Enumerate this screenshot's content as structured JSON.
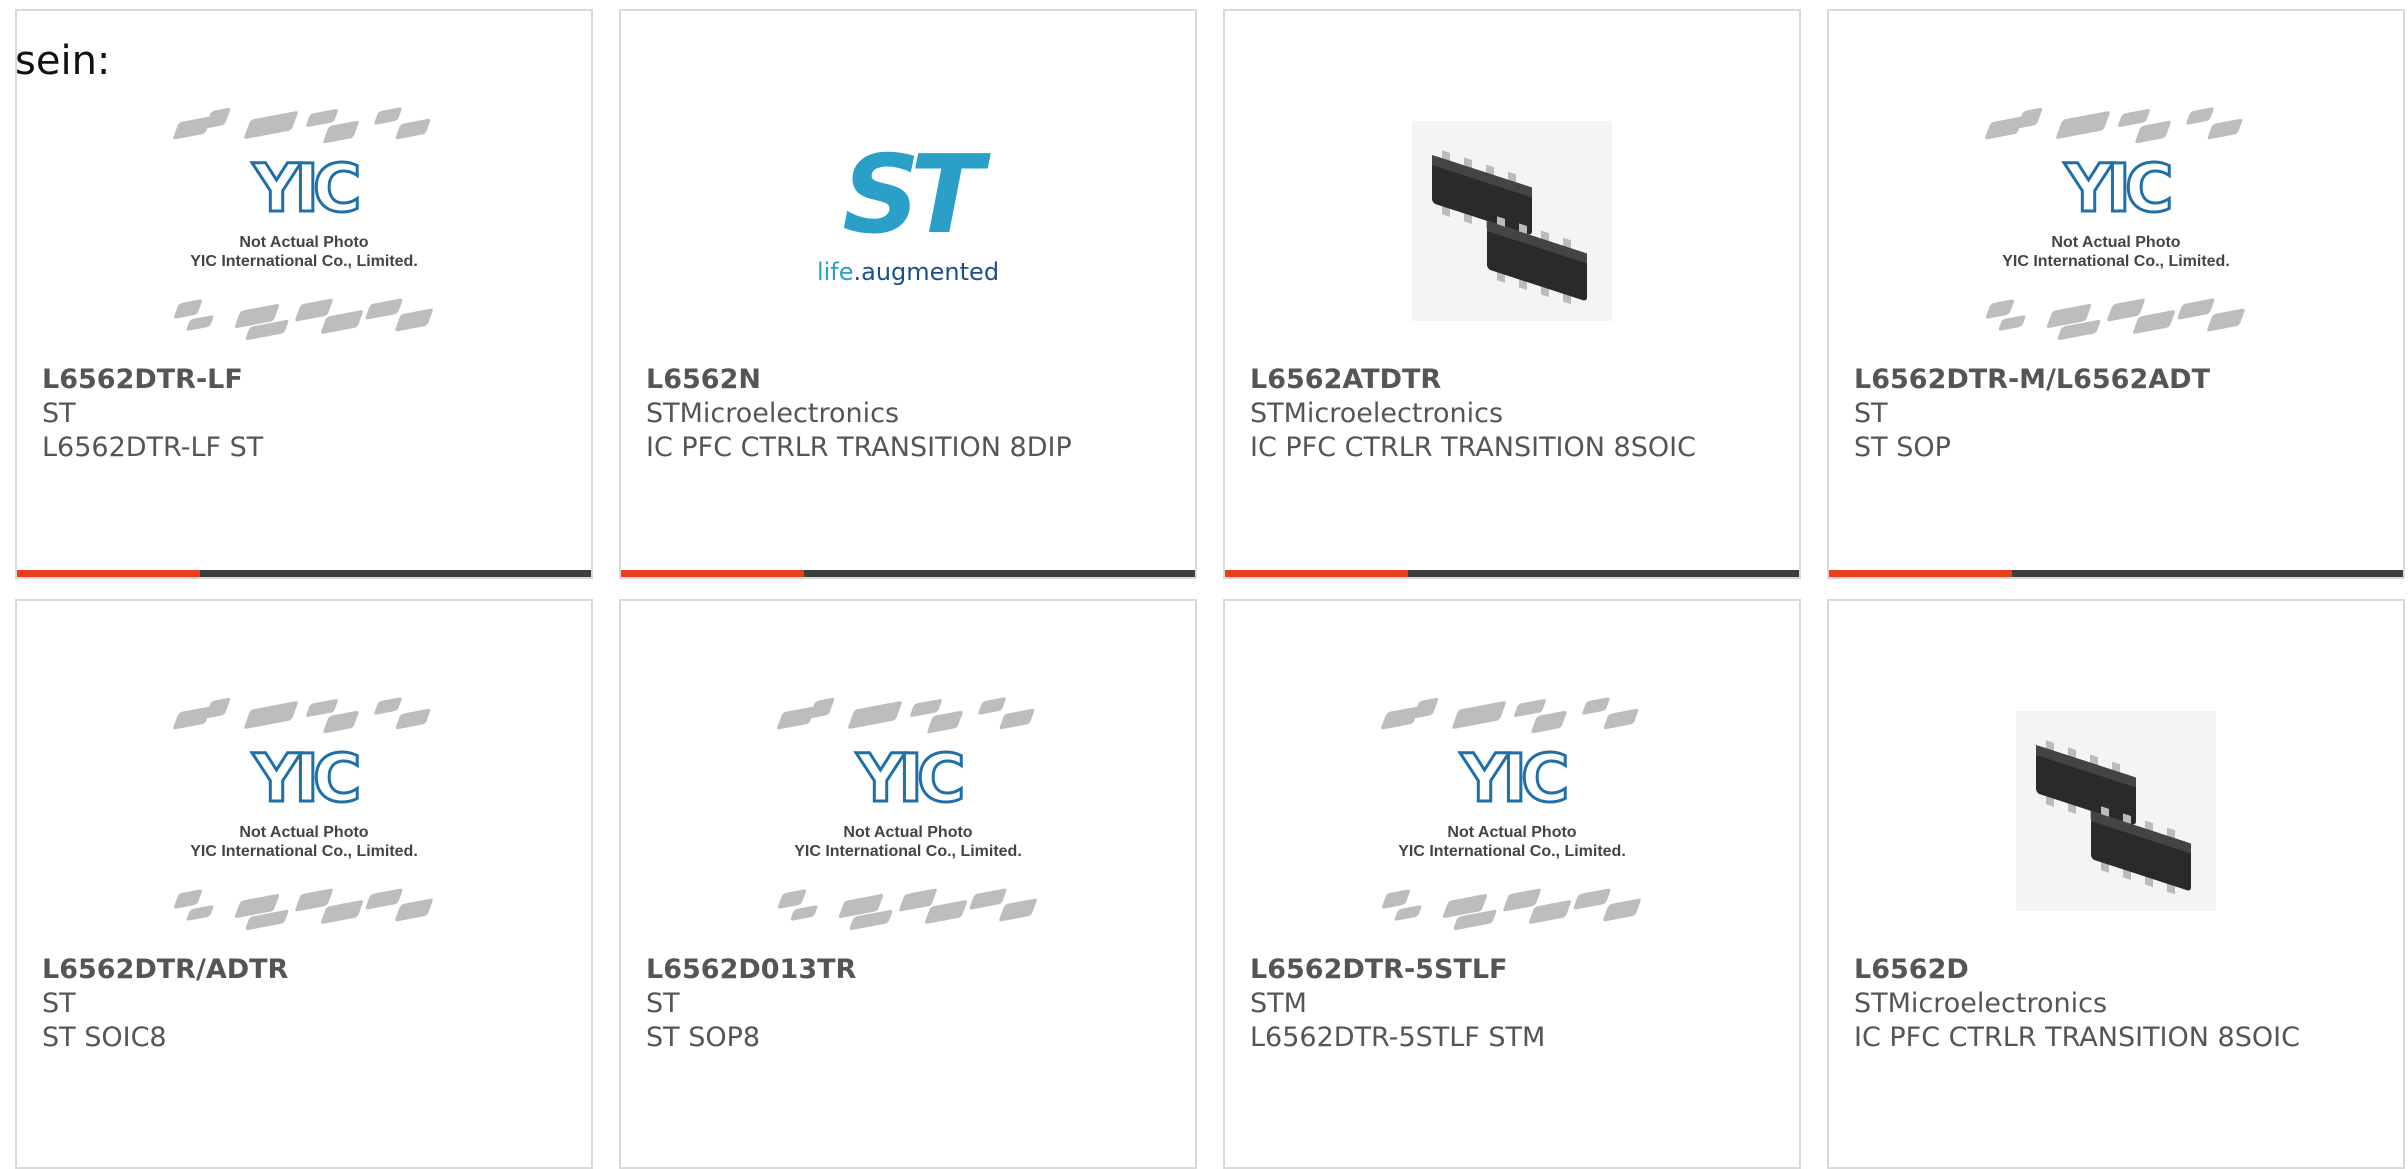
{
  "intro_text": "sein:",
  "placeholder_caption": [
    "Not Actual Photo",
    "YIC International Co., Limited."
  ],
  "logo_text": {
    "yic": "YIC",
    "st": "ST",
    "st_tag_1": "life",
    "st_tag_2": ".augmented"
  },
  "colors": {
    "accent": "#e8401c",
    "bar": "#3d3d3d",
    "border": "#d9d9d9",
    "text": "#555555"
  },
  "products": [
    {
      "part": "L6562DTR-LF",
      "maker": "ST",
      "desc": "L6562DTR-LF ST",
      "image": "yic-placeholder"
    },
    {
      "part": "L6562N",
      "maker": "STMicroelectronics",
      "desc": "IC PFC CTRLR TRANSITION 8DIP",
      "image": "st-logo"
    },
    {
      "part": "L6562ATDTR",
      "maker": "STMicroelectronics",
      "desc": "IC PFC CTRLR TRANSITION 8SOIC",
      "image": "soic-photo"
    },
    {
      "part": "L6562DTR-M/L6562ADT",
      "maker": "ST",
      "desc": "ST SOP",
      "image": "yic-placeholder"
    },
    {
      "part": "L6562DTR/ADTR",
      "maker": "ST",
      "desc": "ST SOIC8",
      "image": "yic-placeholder"
    },
    {
      "part": "L6562D013TR",
      "maker": "ST",
      "desc": "ST SOP8",
      "image": "yic-placeholder"
    },
    {
      "part": "L6562DTR-5STLF",
      "maker": "STM",
      "desc": "L6562DTR-5STLF STM",
      "image": "yic-placeholder"
    },
    {
      "part": "L6562D",
      "maker": "STMicroelectronics",
      "desc": "IC PFC CTRLR TRANSITION 8SOIC",
      "image": "soic-photo"
    }
  ]
}
